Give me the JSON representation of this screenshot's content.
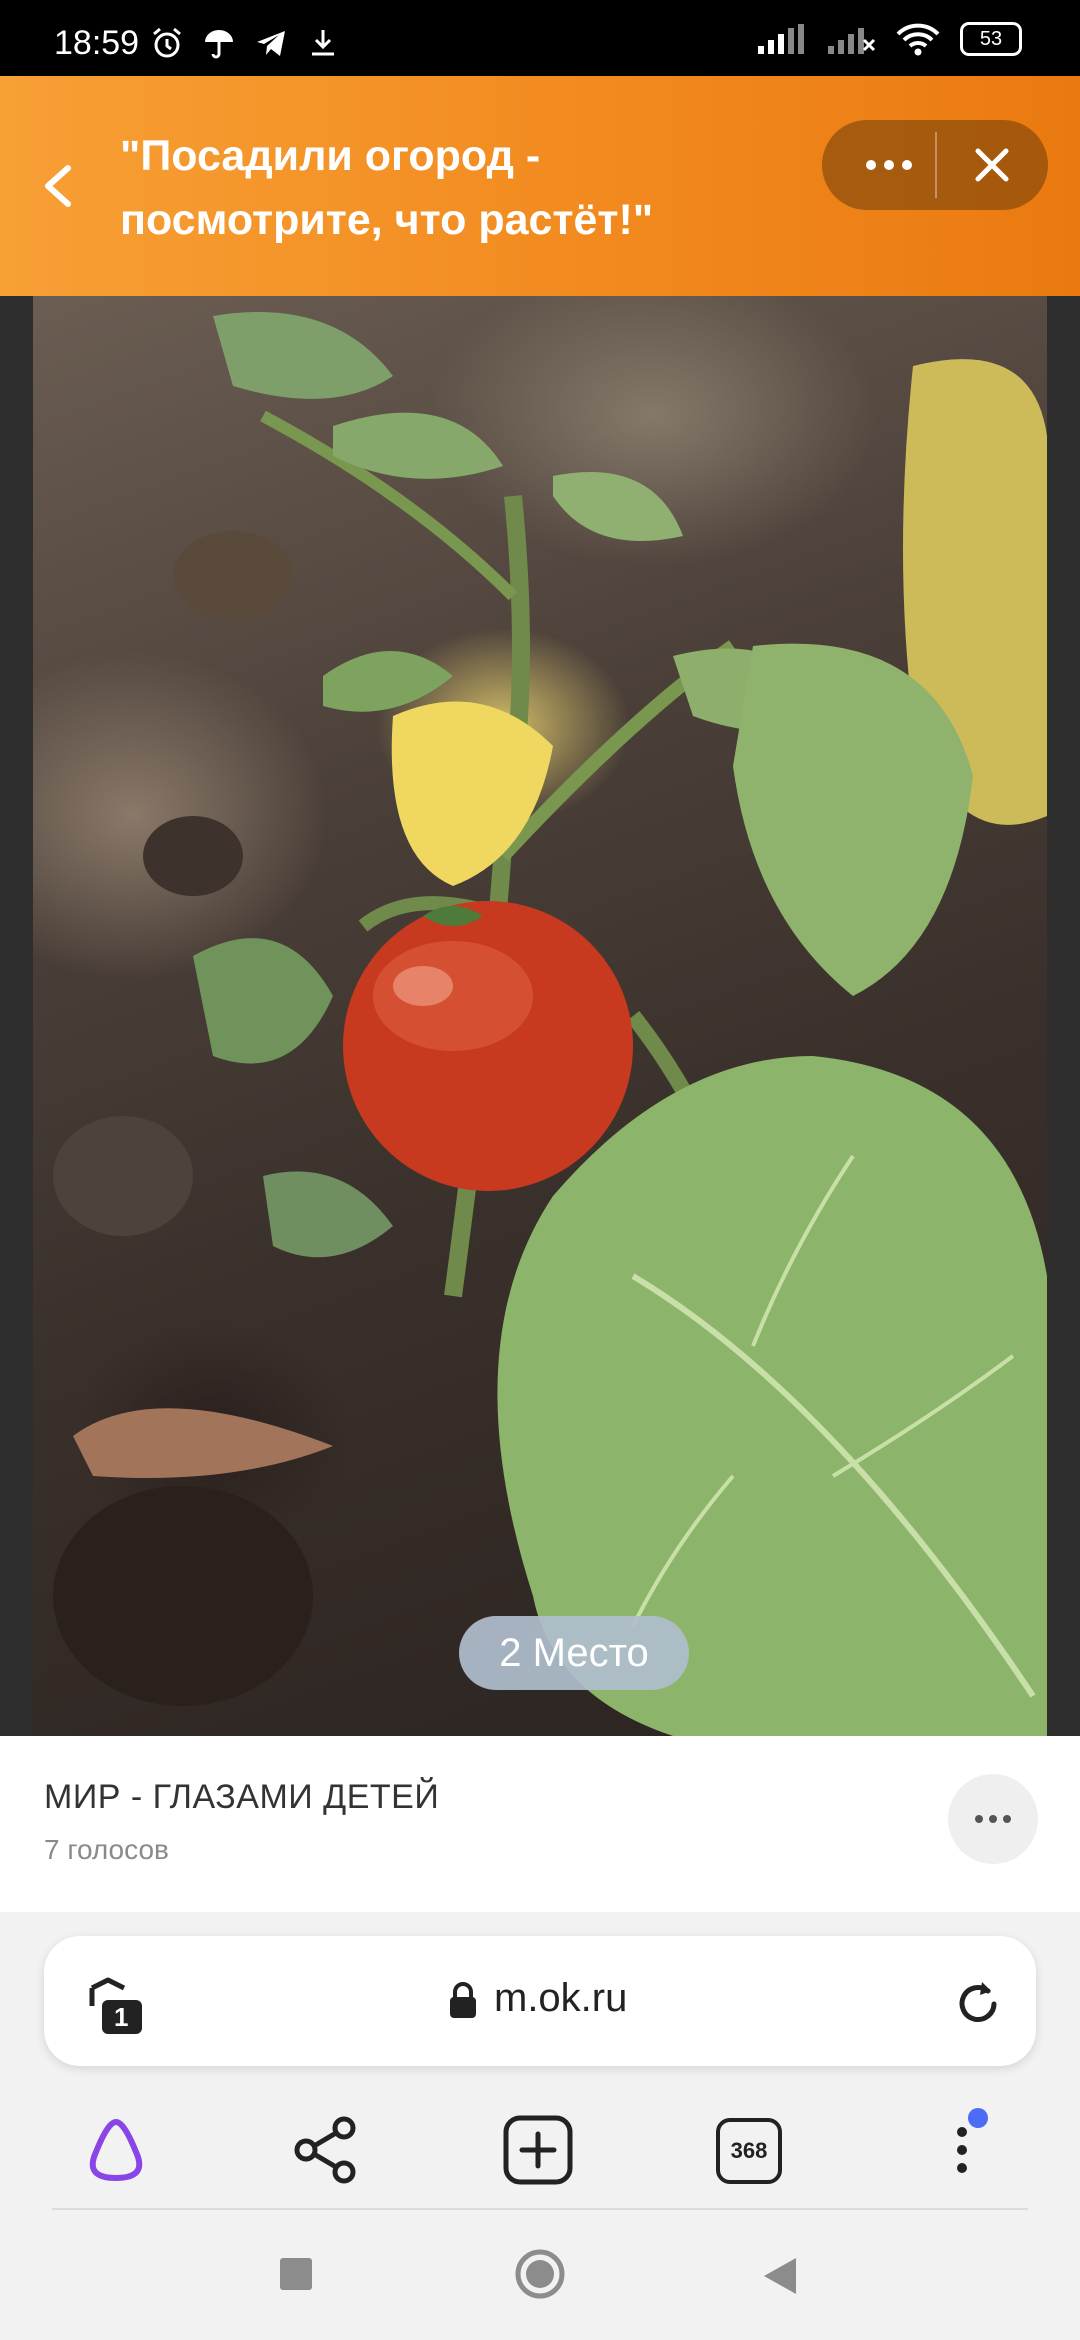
{
  "status_bar": {
    "time": "18:59",
    "battery": "53",
    "left_icons": [
      "alarm-icon",
      "umbrella-icon",
      "telegram-icon",
      "download-icon"
    ],
    "right_icons": [
      "signal-icon",
      "signal-muted-icon",
      "wifi-icon",
      "battery-icon"
    ]
  },
  "header": {
    "title": "\"Посадили огород - посмотрите, что растёт!\"",
    "background_color": "#f28a1f"
  },
  "photo": {
    "place_badge": "2 Место",
    "subject": "tomato-plant-photo"
  },
  "info": {
    "album_title": "МИР - ГЛАЗАМИ ДЕТЕЙ",
    "votes": "7 голосов"
  },
  "browser": {
    "url": "m.ok.ru",
    "tab_shield_count": "1",
    "tabs_count": "368",
    "accent_color": "#8a45e6",
    "notification_color": "#4a6cf7"
  }
}
